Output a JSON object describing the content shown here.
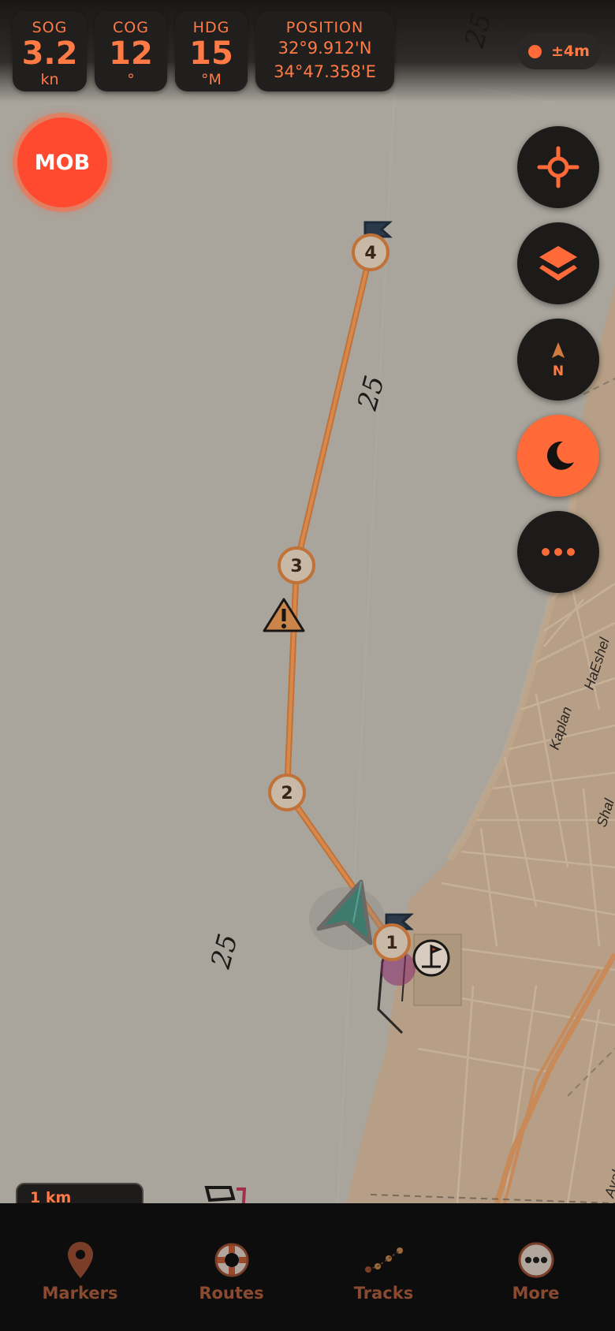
{
  "telemetry": {
    "sog": {
      "label": "SOG",
      "value": "3.2",
      "unit": "kn"
    },
    "cog": {
      "label": "COG",
      "value": "12",
      "unit": "°"
    },
    "hdg": {
      "label": "HDG",
      "value": "15",
      "unit": "°M"
    },
    "position": {
      "label": "POSITION",
      "lat": "32°9.912'N",
      "lon": "34°47.358'E"
    }
  },
  "gps_accuracy": "±4m",
  "mob_label": "MOB",
  "map_controls": [
    {
      "id": "center",
      "icon": "crosshair-icon",
      "active": false
    },
    {
      "id": "layers",
      "icon": "layers-icon",
      "active": false
    },
    {
      "id": "north",
      "icon": "north-up-icon",
      "label": "N",
      "active": false
    },
    {
      "id": "night",
      "icon": "moon-icon",
      "active": true
    },
    {
      "id": "more",
      "icon": "more-dots-icon",
      "active": false
    }
  ],
  "route": {
    "waypoints": [
      "1",
      "2",
      "3",
      "4"
    ]
  },
  "map_labels": {
    "depth_labels": [
      "25",
      "25",
      "25"
    ],
    "streets": [
      "HaEshel",
      "Kaplan",
      "Shal",
      "Ayalon"
    ]
  },
  "scale_bar": "1 km",
  "bottom_nav": [
    {
      "label": "Markers",
      "icon": "map-pin-icon"
    },
    {
      "label": "Routes",
      "icon": "lifebuoy-icon"
    },
    {
      "label": "Tracks",
      "icon": "track-dots-icon"
    },
    {
      "label": "More",
      "icon": "more-dots-icon"
    }
  ],
  "colors": {
    "accent": "#ff7a45",
    "route": "#c87840",
    "vessel": "#3e7a6e"
  }
}
